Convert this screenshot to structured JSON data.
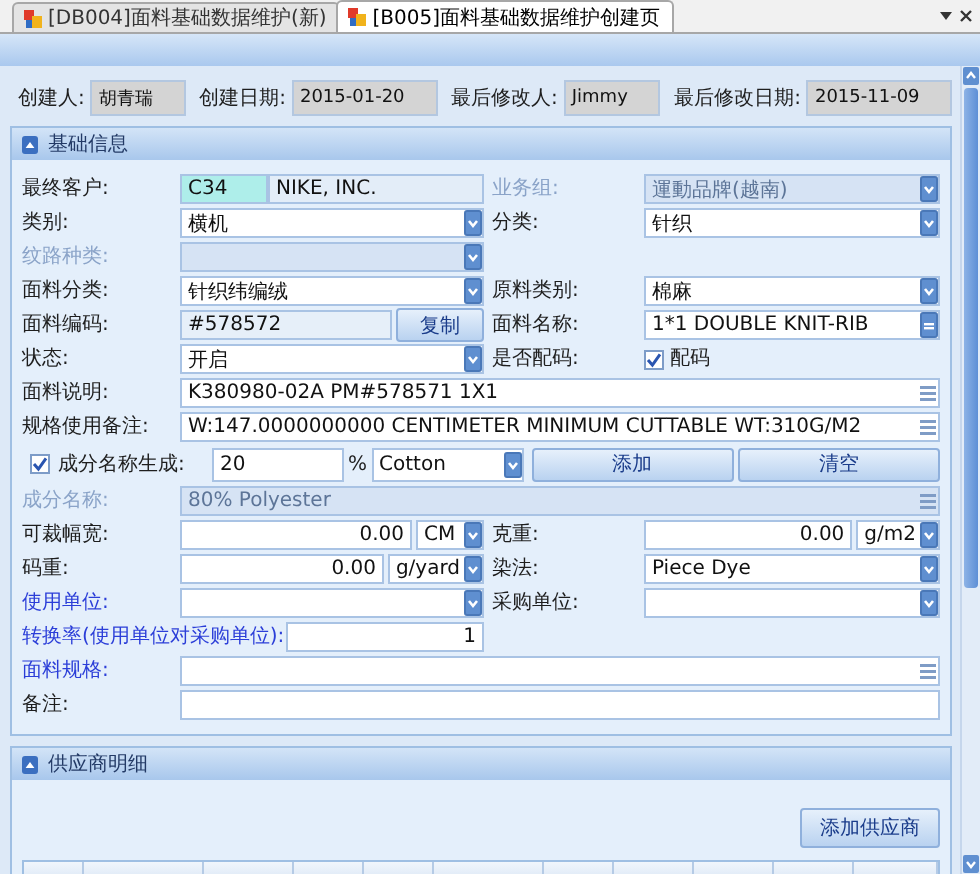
{
  "tabs": [
    {
      "label": "[DB004]面料基础数据维护(新)",
      "selected": false
    },
    {
      "label": "[B005]面料基础数据维护创建页",
      "selected": true
    }
  ],
  "header": [
    {
      "label": "创建人:",
      "value": "胡青瑞"
    },
    {
      "label": "创建日期:",
      "value": "2015-01-20"
    },
    {
      "label": "最后修改人:",
      "value": "Jimmy"
    },
    {
      "label": "最后修改日期:",
      "value": "2015-11-09"
    }
  ],
  "basic_info": {
    "title": "基础信息",
    "expanded": true,
    "rows": [
      {
        "kind": "pair",
        "cells": [
          {
            "label": "最终客户:",
            "link": false,
            "disabled": false,
            "kind": "code-name",
            "code": "C34",
            "value": "NIKE, INC."
          },
          {
            "label": "业务组:",
            "link": false,
            "disabled": true,
            "kind": "combo",
            "value": "運動品牌(越南)"
          }
        ]
      },
      {
        "kind": "pair",
        "cells": [
          {
            "label": "类别:",
            "link": false,
            "disabled": false,
            "kind": "combo",
            "value": "横机"
          },
          {
            "label": "分类:",
            "link": false,
            "disabled": false,
            "kind": "combo",
            "value": "针织"
          }
        ]
      },
      {
        "kind": "pair",
        "cells": [
          {
            "label": "纹路种类:",
            "link": false,
            "disabled": true,
            "kind": "combo"
          }
        ]
      },
      {
        "kind": "pair",
        "cells": [
          {
            "label": "面料分类:",
            "link": false,
            "disabled": false,
            "kind": "combo",
            "value": "针织纬编绒"
          },
          {
            "label": "原料类别:",
            "link": false,
            "disabled": false,
            "kind": "combo",
            "value": "棉麻"
          }
        ]
      },
      {
        "kind": "pair",
        "cells": [
          {
            "label": "面料编码:",
            "link": false,
            "disabled": false,
            "kind": "text-button",
            "value": "#578572",
            "button": "复制"
          },
          {
            "label": "面料名称:",
            "link": false,
            "disabled": false,
            "kind": "ellipsis",
            "value": "1*1 DOUBLE KNIT-RIB"
          }
        ]
      },
      {
        "kind": "pair",
        "cells": [
          {
            "label": "状态:",
            "link": false,
            "disabled": false,
            "kind": "combo",
            "value": "开启"
          },
          {
            "label": "是否配码:",
            "link": false,
            "disabled": false,
            "kind": "check",
            "caption": "配码",
            "checked": true
          }
        ]
      },
      {
        "kind": "full",
        "cells": [
          {
            "label": "面料说明:",
            "link": false,
            "disabled": false,
            "kind": "memo",
            "value": "K380980-02A    PM#578571    1X1"
          }
        ]
      },
      {
        "kind": "full",
        "cells": [
          {
            "label": "规格使用备注:",
            "link": false,
            "disabled": false,
            "kind": "memo",
            "value": "W:147.0000000000 CENTIMETER    MINIMUM CUTTABLE    WT:310G/M2"
          }
        ]
      },
      {
        "kind": "composition",
        "label": "成分名称生成:",
        "checked": true,
        "percent": "20",
        "percent_sign": "%",
        "material": "Cotton",
        "add_button": "添加",
        "clear_button": "清空"
      },
      {
        "kind": "full",
        "cells": [
          {
            "label": "成分名称:",
            "link": false,
            "disabled": true,
            "kind": "memo",
            "value": "80% Polyester"
          }
        ]
      },
      {
        "kind": "pair",
        "cells": [
          {
            "label": "可裁幅宽:",
            "link": false,
            "disabled": false,
            "kind": "number-unit",
            "value": "0.00",
            "unit": "CM"
          },
          {
            "label": "克重:",
            "link": false,
            "disabled": false,
            "kind": "number-unit",
            "value": "0.00",
            "unit": "g/m2"
          }
        ]
      },
      {
        "kind": "pair",
        "cells": [
          {
            "label": "码重:",
            "link": false,
            "disabled": false,
            "kind": "number-unit",
            "value": "0.00",
            "unit": "g/yard"
          },
          {
            "label": "染法:",
            "link": false,
            "disabled": false,
            "kind": "combo",
            "value": "Piece Dye"
          }
        ]
      },
      {
        "kind": "pair",
        "cells": [
          {
            "label": "使用单位:",
            "link": true,
            "disabled": false,
            "kind": "combo"
          },
          {
            "label": "采购单位:",
            "link": false,
            "disabled": false,
            "kind": "combo"
          }
        ]
      },
      {
        "kind": "wide-label",
        "cells": [
          {
            "label": "转换率(使用单位对采购单位):",
            "link": true,
            "disabled": false,
            "kind": "number",
            "value": "1"
          }
        ]
      },
      {
        "kind": "full",
        "cells": [
          {
            "label": "面料规格:",
            "link": true,
            "disabled": false,
            "kind": "memo"
          }
        ]
      },
      {
        "kind": "full",
        "cells": [
          {
            "label": "备注:",
            "link": false,
            "disabled": false,
            "kind": "text"
          }
        ]
      }
    ]
  },
  "supplier": {
    "title": "供应商明细",
    "expanded": true,
    "add_button": "添加供应商"
  }
}
